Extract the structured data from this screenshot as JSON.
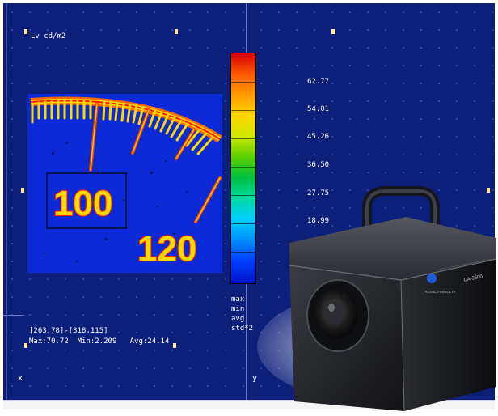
{
  "app": {
    "unit_label": "Lv cd/m2",
    "selection_range": "[263,78]-[318,115]",
    "stats_line": "Max:70.72  Min:2.209   Avg:24.14",
    "axis_x_label": "x",
    "axis_y_label": "y"
  },
  "scale": {
    "values": [
      "62.77",
      "54.01",
      "45.26",
      "36.50",
      "27.75",
      "18.99"
    ]
  },
  "stats_legend": [
    "max",
    "min",
    "avg",
    "std*2"
  ],
  "meter_image": {
    "readings": [
      "100",
      "120"
    ]
  },
  "device": {
    "model": "CA-2500",
    "brand": "KONICA MINOLTA"
  },
  "colors": {
    "panel_bg": "#0c1f7a",
    "map_bg": "#0a2ad8",
    "colorbar_top": "#d40000",
    "colorbar_bottom": "#0015c8"
  }
}
